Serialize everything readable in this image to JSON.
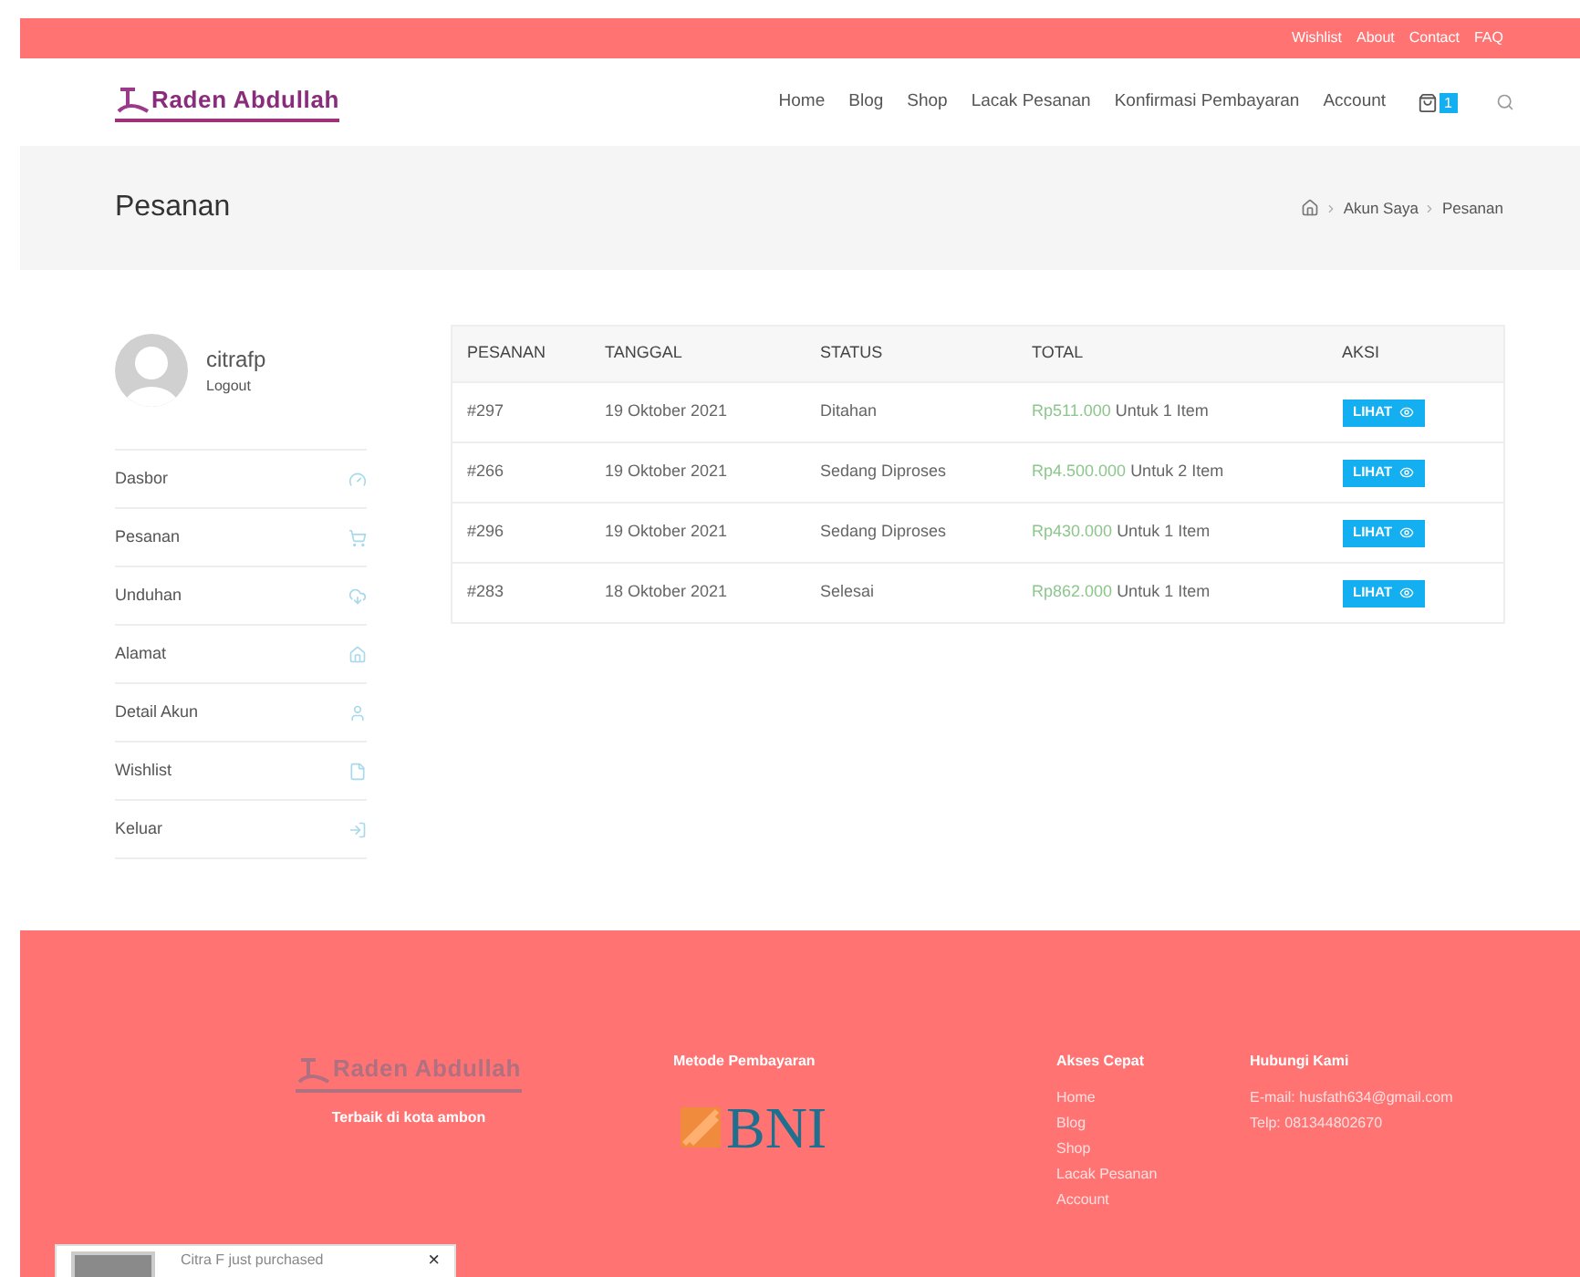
{
  "top_bar": {
    "links": [
      "Wishlist",
      "About",
      "Contact",
      "FAQ"
    ]
  },
  "header": {
    "logo": "Raden Abdullah",
    "nav": [
      "Home",
      "Blog",
      "Shop",
      "Lacak Pesanan",
      "Konfirmasi Pembayaran",
      "Account"
    ],
    "cart_count": "1"
  },
  "page_title": "Pesanan",
  "breadcrumb": [
    "Akun Saya",
    "Pesanan"
  ],
  "user": {
    "name": "citrafp",
    "logout": "Logout"
  },
  "sidebar": {
    "items": [
      "Dasbor",
      "Pesanan",
      "Unduhan",
      "Alamat",
      "Detail Akun",
      "Wishlist",
      "Keluar"
    ]
  },
  "table": {
    "columns": [
      "PESANAN",
      "TANGGAL",
      "STATUS",
      "TOTAL",
      "AKSI"
    ],
    "rows": [
      {
        "order": "#297",
        "date": "19 Oktober 2021",
        "status": "Ditahan",
        "amount": "Rp511.000",
        "items": "Untuk 1 Item",
        "action": "LIHAT"
      },
      {
        "order": "#266",
        "date": "19 Oktober 2021",
        "status": "Sedang Diproses",
        "amount": "Rp4.500.000",
        "items": "Untuk 2 Item",
        "action": "LIHAT"
      },
      {
        "order": "#296",
        "date": "19 Oktober 2021",
        "status": "Sedang Diproses",
        "amount": "Rp430.000",
        "items": "Untuk 1 Item",
        "action": "LIHAT"
      },
      {
        "order": "#283",
        "date": "18 Oktober 2021",
        "status": "Selesai",
        "amount": "Rp862.000",
        "items": "Untuk 1 Item",
        "action": "LIHAT"
      }
    ]
  },
  "footer": {
    "logo": "Raden Abdullah",
    "tagline": "Terbaik di kota ambon",
    "payment": {
      "title": "Metode Pembayaran",
      "bank": "BNI"
    },
    "quick_links": {
      "title": "Akses Cepat",
      "links": [
        "Home",
        "Blog",
        "Shop",
        "Lacak Pesanan",
        "Account"
      ]
    },
    "contact": {
      "title": "Hubungi Kami",
      "lines": [
        "E-mail: husfath634@gmail.com",
        "Telp: 081344802670"
      ]
    }
  },
  "popup": {
    "text": "Citra F just purchased",
    "close": "×"
  }
}
